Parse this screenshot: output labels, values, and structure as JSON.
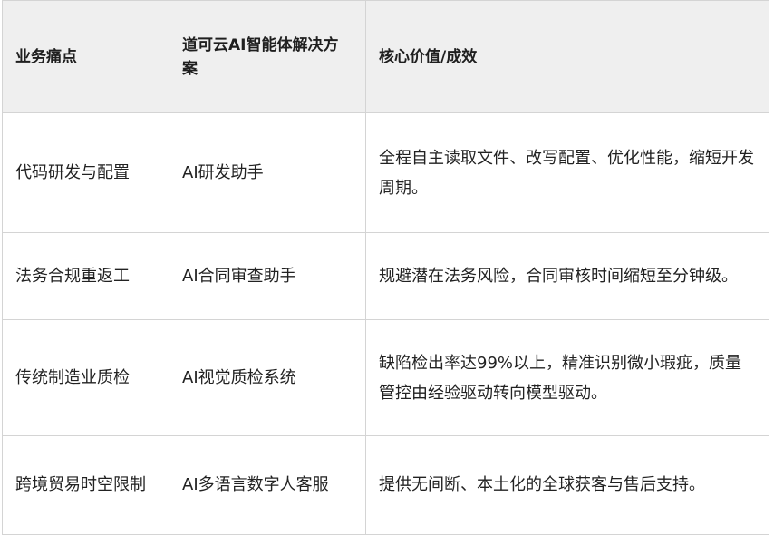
{
  "headers": [
    "业务痛点",
    "道可云AI智能体解决方案",
    "核心价值/成效"
  ],
  "rows": [
    {
      "pain_point": "代码研发与配置",
      "solution": "AI研发助手",
      "value": "全程自主读取文件、改写配置、优化性能，缩短开发周期。"
    },
    {
      "pain_point": "法务合规重返工",
      "solution": "AI合同审查助手",
      "value": "规避潜在法务风险，合同审核时间缩短至分钟级。"
    },
    {
      "pain_point": "传统制造业质检",
      "solution": "AI视觉质检系统",
      "value": "缺陷检出率达99%以上，精准识别微小瑕疵，质量管控由经验驱动转向模型驱动。"
    },
    {
      "pain_point": "跨境贸易时空限制",
      "solution": "AI多语言数字人客服",
      "value": "提供无间断、本土化的全球获客与售后支持。"
    }
  ]
}
